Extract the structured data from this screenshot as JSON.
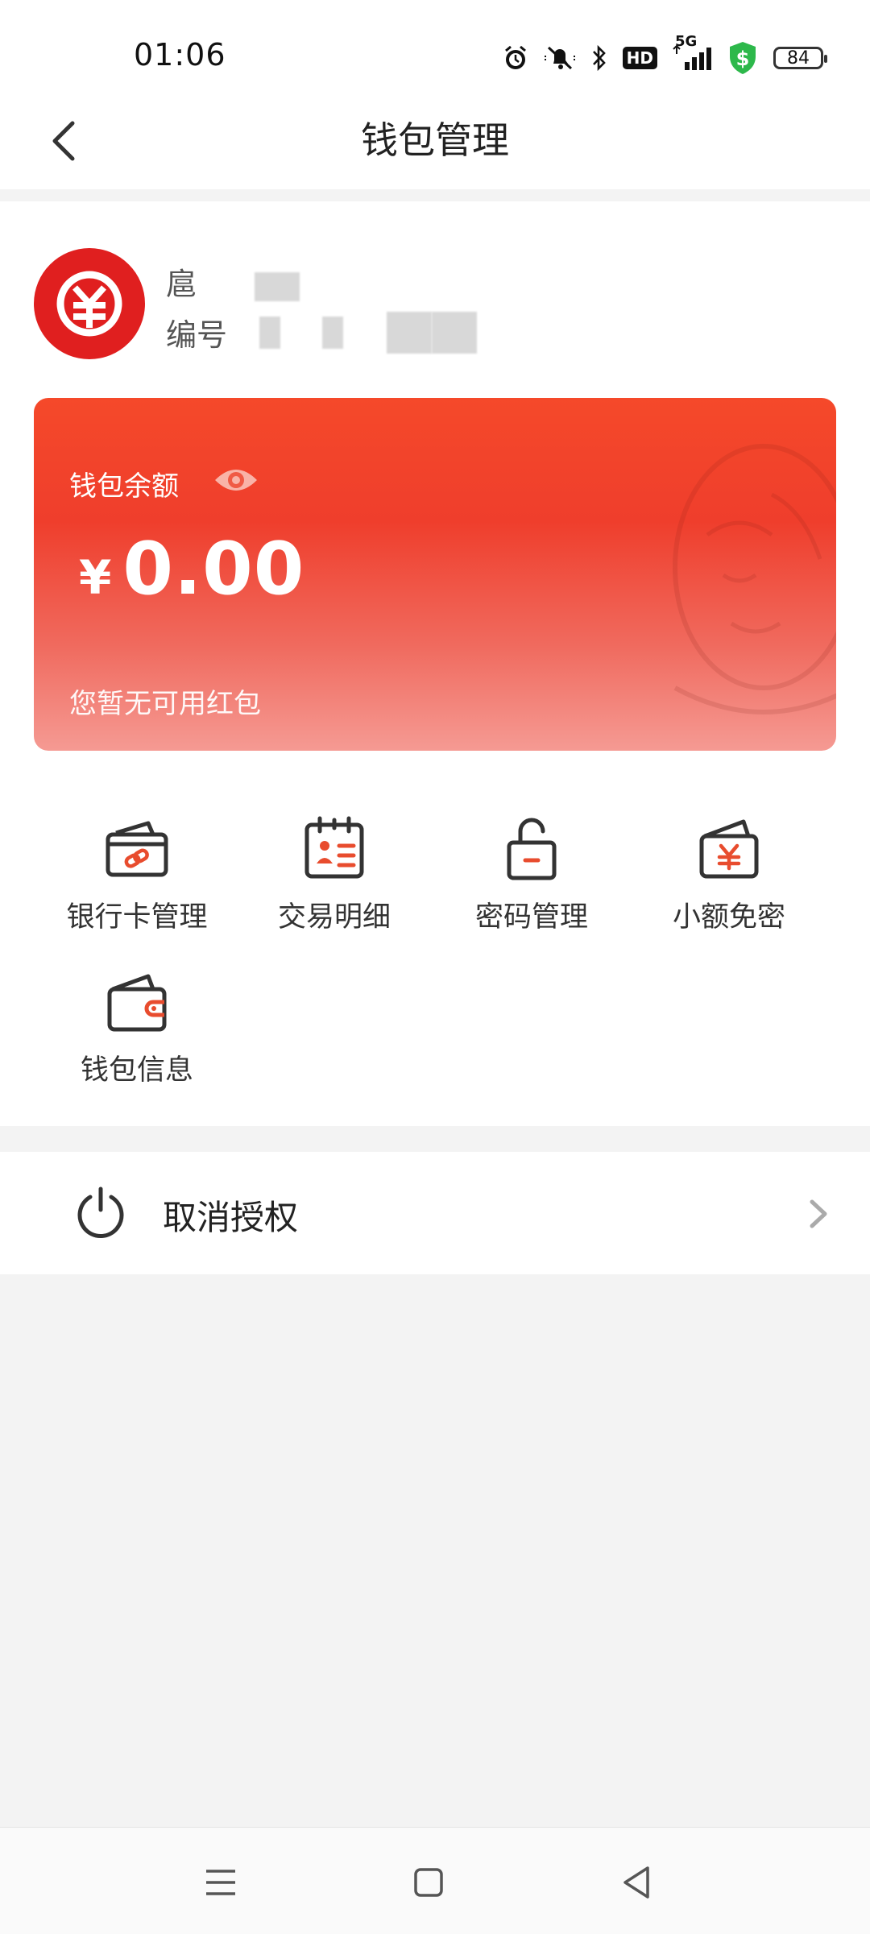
{
  "status_bar": {
    "time": "01:06",
    "network": "5G",
    "hd": "HD",
    "battery": "84",
    "icons": [
      "alarm-icon",
      "mute-icon",
      "bluetooth-icon",
      "hd-icon",
      "signal-icon",
      "shield-dollar-icon",
      "battery-icon"
    ]
  },
  "header": {
    "title": "钱包管理",
    "back_icon": "chevron-left-icon"
  },
  "profile": {
    "avatar_icon": "digital-yuan-icon",
    "name_prefix": "扈",
    "id_label": "编号"
  },
  "balance_card": {
    "label": "钱包余额",
    "eye_icon": "eye-icon",
    "currency": "¥",
    "amount": "0.00",
    "redpacket_text": "您暂无可用红包",
    "colors": {
      "top": "#f5492a",
      "bottom": "#f59a93"
    }
  },
  "actions": [
    {
      "label": "银行卡管理",
      "icon": "bank-card-link-icon"
    },
    {
      "label": "交易明细",
      "icon": "transaction-calendar-icon"
    },
    {
      "label": "密码管理",
      "icon": "unlock-icon"
    },
    {
      "label": "小额免密",
      "icon": "yuan-wallet-icon"
    },
    {
      "label": "钱包信息",
      "icon": "wallet-icon"
    }
  ],
  "deauth": {
    "label": "取消授权",
    "icon": "power-icon"
  },
  "nav_bar": {
    "buttons": [
      "menu-icon",
      "home-square-icon",
      "back-triangle-icon"
    ]
  },
  "accent_color": "#e84c2e"
}
